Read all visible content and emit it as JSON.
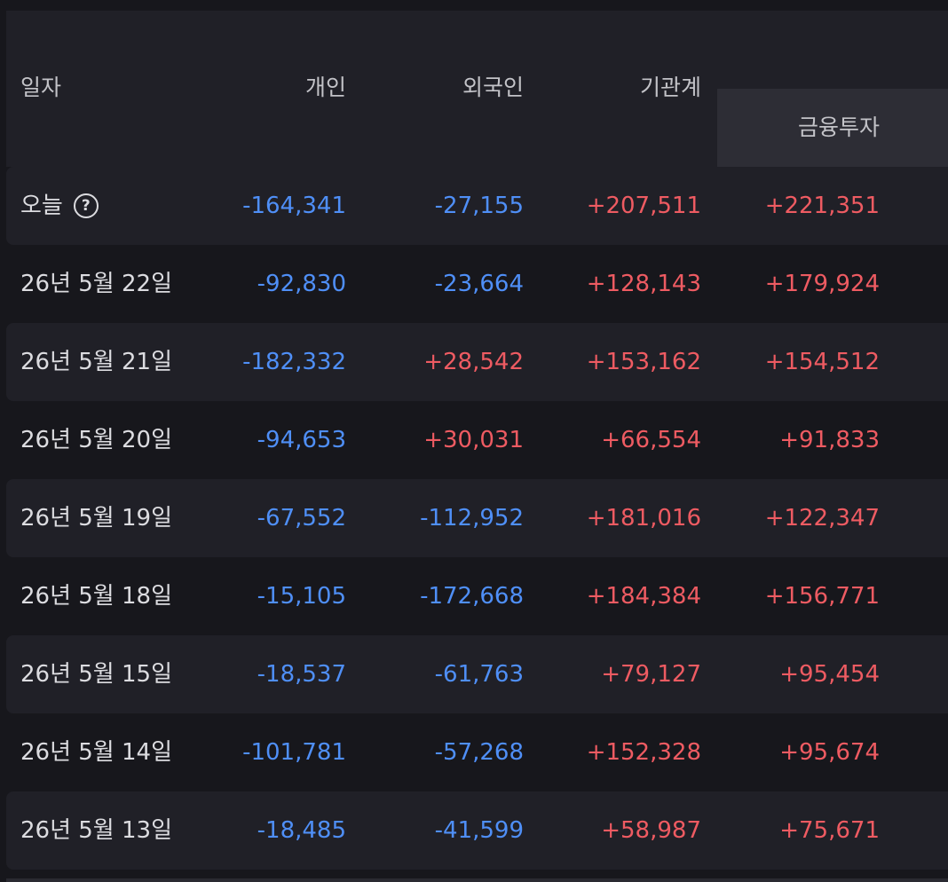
{
  "table": {
    "headers": {
      "date": "일자",
      "individual": "개인",
      "foreign": "외국인",
      "institution_total": "기관계",
      "financial_investment": "금융투자"
    },
    "today_help_icon": "question-circle-icon",
    "rows": [
      {
        "date": "오늘",
        "individual": "-164,341",
        "foreign": "-27,155",
        "institution_total": "+207,511",
        "financial_investment": "+221,351"
      },
      {
        "date": "26년 5월 22일",
        "individual": "-92,830",
        "foreign": "-23,664",
        "institution_total": "+128,143",
        "financial_investment": "+179,924"
      },
      {
        "date": "26년 5월 21일",
        "individual": "-182,332",
        "foreign": "+28,542",
        "institution_total": "+153,162",
        "financial_investment": "+154,512"
      },
      {
        "date": "26년 5월 20일",
        "individual": "-94,653",
        "foreign": "+30,031",
        "institution_total": "+66,554",
        "financial_investment": "+91,833"
      },
      {
        "date": "26년 5월 19일",
        "individual": "-67,552",
        "foreign": "-112,952",
        "institution_total": "+181,016",
        "financial_investment": "+122,347"
      },
      {
        "date": "26년 5월 18일",
        "individual": "-15,105",
        "foreign": "-172,668",
        "institution_total": "+184,384",
        "financial_investment": "+156,771"
      },
      {
        "date": "26년 5월 15일",
        "individual": "-18,537",
        "foreign": "-61,763",
        "institution_total": "+79,127",
        "financial_investment": "+95,454"
      },
      {
        "date": "26년 5월 14일",
        "individual": "-101,781",
        "foreign": "-57,268",
        "institution_total": "+152,328",
        "financial_investment": "+95,674"
      },
      {
        "date": "26년 5월 13일",
        "individual": "-18,485",
        "foreign": "-41,599",
        "institution_total": "+58,987",
        "financial_investment": "+75,671"
      }
    ]
  },
  "colors": {
    "negative": "#4f8ff7",
    "positive": "#ee5b62",
    "background": "#17171c",
    "row_alt": "#202027",
    "header_highlight": "#2d2d35"
  }
}
